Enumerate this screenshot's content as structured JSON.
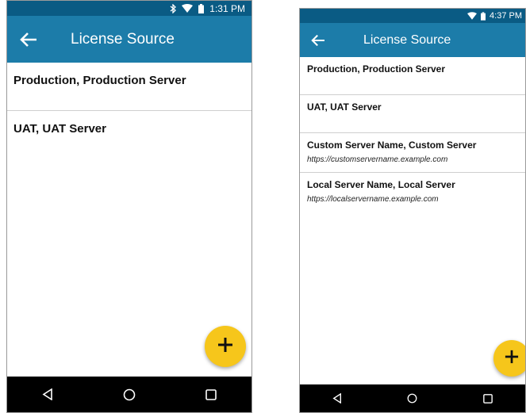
{
  "screens": [
    {
      "status": {
        "time": "1:31 PM",
        "icons": [
          "bluetooth-icon",
          "wifi-icon",
          "battery-icon"
        ]
      },
      "app_bar": {
        "title": "License Source",
        "back_icon": "arrow-left-icon"
      },
      "servers": [
        {
          "name": "Production, Production Server"
        },
        {
          "name": "UAT, UAT Server"
        }
      ],
      "fab_icon": "plus-icon",
      "nav": [
        "back-triangle-icon",
        "home-circle-icon",
        "recents-square-icon"
      ]
    },
    {
      "status": {
        "time": "4:37 PM",
        "icons": [
          "wifi-icon",
          "battery-icon"
        ]
      },
      "app_bar": {
        "title": "License Source",
        "back_icon": "arrow-left-icon"
      },
      "servers": [
        {
          "name": "Production, Production Server"
        },
        {
          "name": "UAT, UAT Server"
        },
        {
          "name": "Custom Server Name, Custom Server",
          "url": "https://customservername.example.com"
        },
        {
          "name": "Local Server Name, Local Server",
          "url": "https://localservername.example.com"
        }
      ],
      "fab_icon": "plus-icon",
      "nav": [
        "back-triangle-icon",
        "home-circle-icon",
        "recents-square-icon"
      ]
    }
  ],
  "colors": {
    "status_bar": "#0a5b84",
    "app_bar": "#1c7ca9",
    "fab": "#f6c61b",
    "nav_bar": "#000000",
    "divider": "#cfcfcf"
  }
}
